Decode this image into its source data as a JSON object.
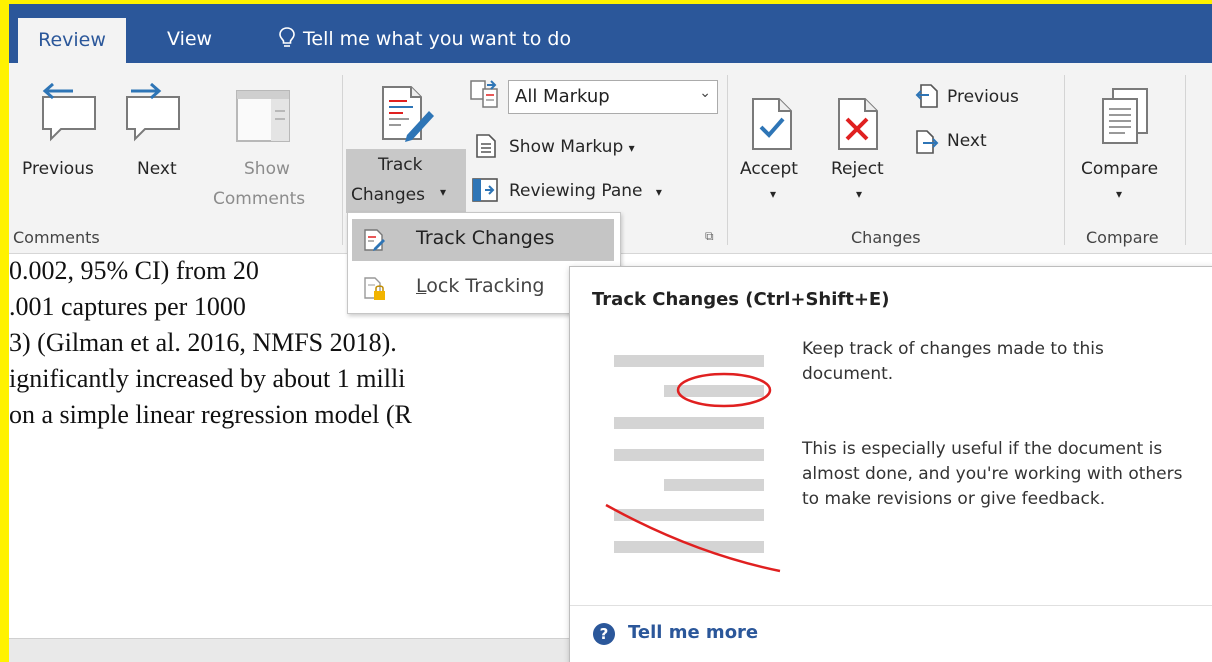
{
  "tabs": {
    "review": "Review",
    "view": "View",
    "tell_me": "Tell me what you want to do"
  },
  "ribbon": {
    "comments": {
      "previous": "Previous",
      "next": "Next",
      "show": "Show",
      "comments": "Comments",
      "group_label": "Comments"
    },
    "tracking": {
      "track": "Track",
      "changes": "Changes",
      "markup_value": "All Markup",
      "show_markup": "Show Markup",
      "reviewing_pane": "Reviewing Pane"
    },
    "changes": {
      "accept": "Accept",
      "reject": "Reject",
      "previous": "Previous",
      "next": "Next",
      "group_label": "Changes"
    },
    "compare": {
      "compare": "Compare",
      "group_label": "Compare"
    }
  },
  "dropdown": {
    "track_changes": "Track Changes",
    "lock_tracking": "Lock Tracking"
  },
  "tooltip": {
    "title": "Track Changes (Ctrl+Shift+E)",
    "desc1": "Keep track of changes made to this document.",
    "desc2": "This is especially useful if the document is almost done, and you're working with others to make revisions or give feedback.",
    "tell_more": "Tell me more"
  },
  "document": {
    "lines": [
      "0.002, 95% CI) from 20",
      ".001 captures per 1000",
      "3) (Gilman et al. 2016, NMFS 2018).",
      "ignificantly increased by about 1 milli",
      "on a simple linear regression model (R"
    ]
  },
  "colors": {
    "accent": "#2B579A",
    "frame": "#FFF200",
    "ribbon_bg": "#F3F3F3",
    "red_mark": "#E02020"
  }
}
